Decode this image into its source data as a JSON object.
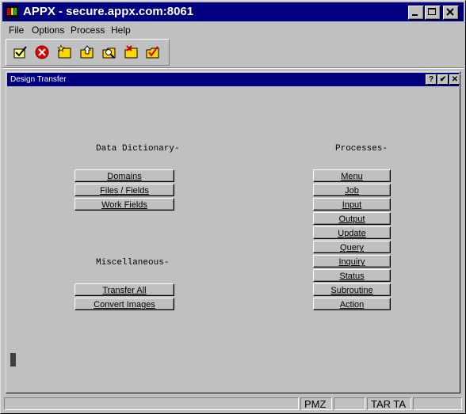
{
  "window": {
    "title": "APPX - secure.appx.com:8061"
  },
  "titlebar_buttons": {
    "minimize": "_",
    "maximize": "□",
    "close": "×"
  },
  "menu": [
    "File",
    "Options",
    "Process",
    "Help"
  ],
  "toolbar": {
    "tools": [
      "check-icon",
      "stop-icon",
      "folder-star-icon",
      "folder-up-icon",
      "folder-search-icon",
      "folder-x-icon",
      "folder-check-icon"
    ]
  },
  "child_window": {
    "title": "Design Transfer",
    "buttons": {
      "help": "?",
      "ok": "✔",
      "close": "✕"
    }
  },
  "sections": {
    "data_dictionary": {
      "label": "Data Dictionary-",
      "buttons": [
        "Domains",
        "Files / Fields",
        "Work Fields"
      ]
    },
    "miscellaneous": {
      "label": "Miscellaneous-",
      "buttons": [
        "Transfer All",
        "Convert Images"
      ]
    },
    "processes": {
      "label": "Processes-",
      "buttons": [
        "Menu",
        "Job",
        "Input",
        "Output",
        "Update",
        "Query",
        "Inquiry",
        "Status",
        "Subroutine",
        "Action"
      ]
    }
  },
  "statusbar": {
    "panes": [
      "",
      "PMZ",
      "",
      "TAR TA",
      ""
    ]
  }
}
